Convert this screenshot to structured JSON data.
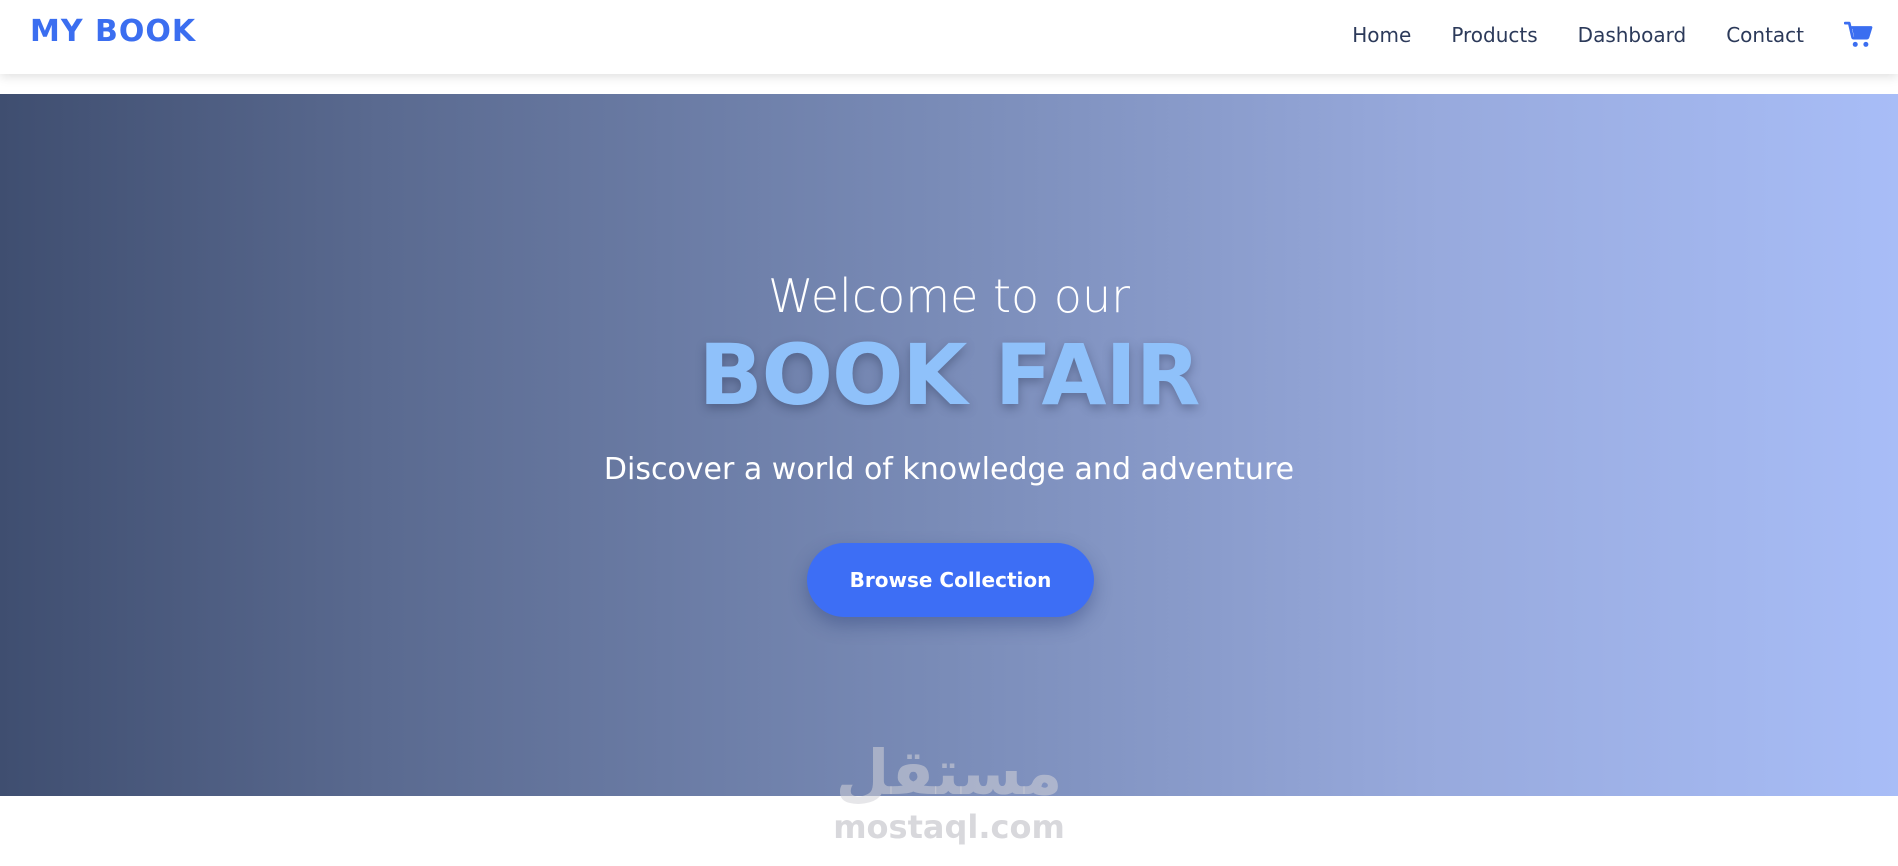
{
  "navbar": {
    "brand": "MY BOOK",
    "links": [
      {
        "label": "Home"
      },
      {
        "label": "Products"
      },
      {
        "label": "Dashboard"
      },
      {
        "label": "Contact"
      }
    ],
    "cart_icon": "shopping-cart-icon"
  },
  "hero": {
    "welcome": "Welcome to our",
    "title": "BOOK FAIR",
    "subtitle": "Discover a world of knowledge and adventure",
    "button_label": "Browse Collection"
  },
  "watermark": {
    "arabic": "مستقل",
    "latin": "mostaql.com"
  },
  "colors": {
    "brand": "#3b6ef0",
    "nav_text": "#2c3a5a",
    "title_accent": "#8fc1fa",
    "button": "#3d6ef5",
    "hero_gradient_start": "#3f4e70",
    "hero_gradient_end": "#a8bdf7"
  }
}
